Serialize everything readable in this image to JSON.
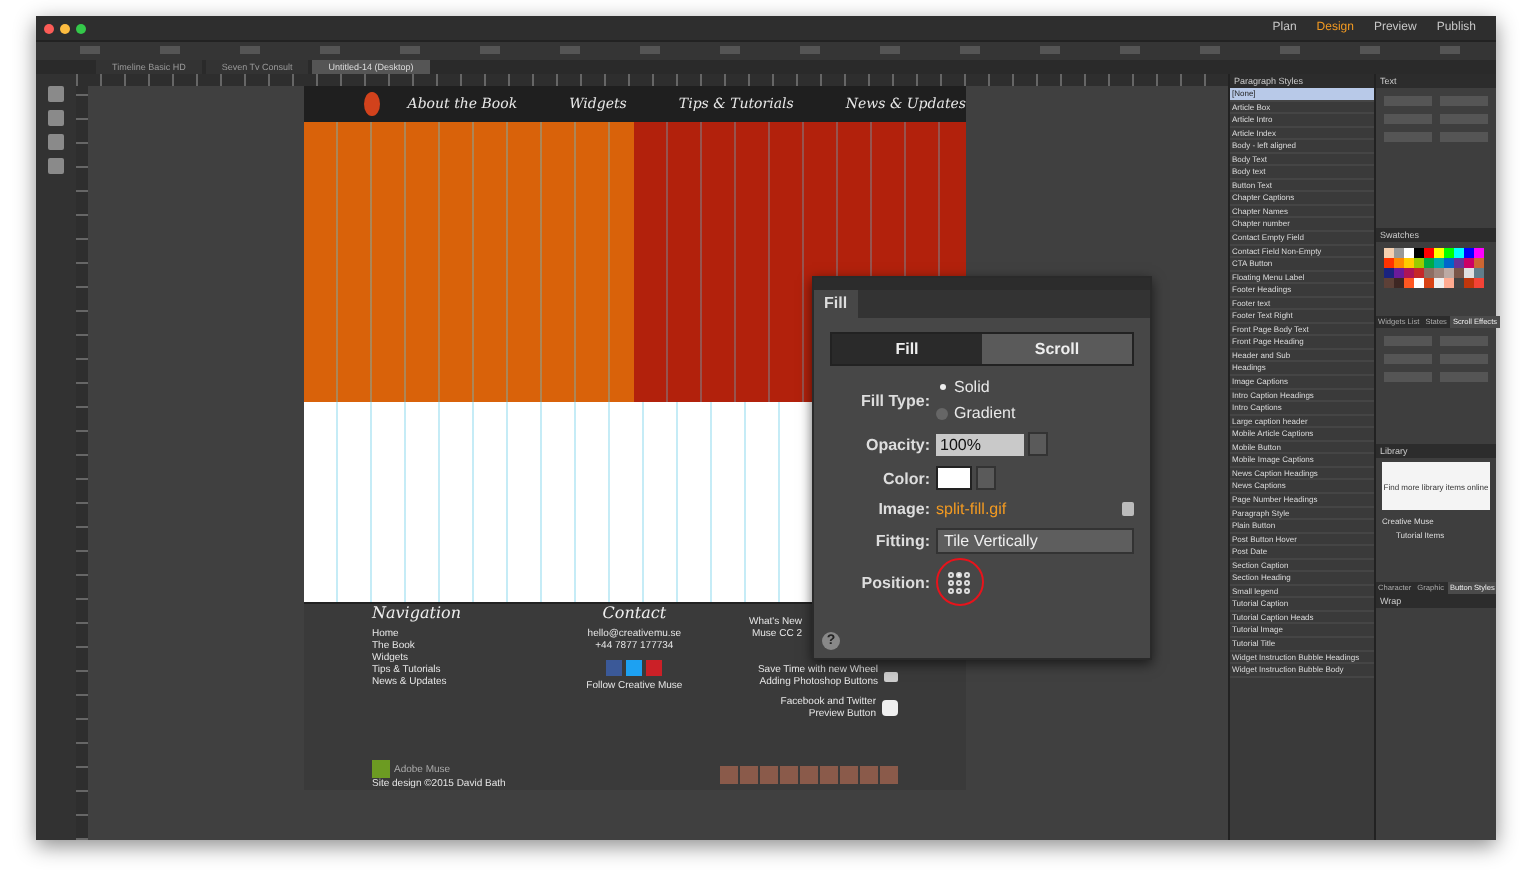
{
  "window": {
    "modes": [
      {
        "label": "Plan",
        "selected": false
      },
      {
        "label": "Design",
        "selected": true
      },
      {
        "label": "Preview",
        "selected": false
      },
      {
        "label": "Publish",
        "selected": false
      }
    ]
  },
  "document_tabs": [
    {
      "label": "Timeline Basic HD",
      "selected": false
    },
    {
      "label": "Seven Tv Consult",
      "selected": false
    },
    {
      "label": "Untitled-14 (Desktop)",
      "selected": true
    }
  ],
  "page": {
    "nav": [
      "About the Book",
      "Widgets",
      "Tips & Tutorials",
      "News & Updates"
    ],
    "footer": {
      "navigation_title": "Navigation",
      "navigation_links": [
        "Home",
        "The Book",
        "Widgets",
        "Tips & Tutorials",
        "News & Updates"
      ],
      "contact_title": "Contact",
      "contact_lines": [
        "hello@creativemu.se",
        "+44 7877 177734"
      ],
      "follow": "Follow Creative Muse",
      "news": [
        "What's New",
        "Muse CC 2"
      ],
      "tips": [
        "Save Time with new Wheel",
        "Adding Photoshop Buttons"
      ],
      "preview": [
        "Facebook and Twitter",
        "Preview Button"
      ],
      "brand": "Adobe Muse",
      "credit": "Site design ©2015 David Bath"
    }
  },
  "fill_panel": {
    "tab": "Fill",
    "toggle": [
      {
        "label": "Fill",
        "selected": true
      },
      {
        "label": "Scroll",
        "selected": false
      }
    ],
    "fill_type_label": "Fill Type:",
    "fill_types": [
      {
        "label": "Solid",
        "selected": true
      },
      {
        "label": "Gradient",
        "selected": false
      }
    ],
    "opacity_label": "Opacity:",
    "opacity": "100%",
    "color_label": "Color:",
    "image_label": "Image:",
    "image": "split-fill.gif",
    "fitting_label": "Fitting:",
    "fitting": "Tile Vertically",
    "position_label": "Position:",
    "help": "?"
  },
  "paragraph_styles": {
    "title": "Paragraph Styles",
    "items": [
      {
        "label": "[None]",
        "selected": true
      },
      {
        "label": "Article Box",
        "selected": false
      },
      {
        "label": "Article Intro",
        "selected": false
      },
      {
        "label": "Article Index",
        "selected": false
      },
      {
        "label": "Body - left aligned",
        "selected": false
      },
      {
        "label": "Body Text",
        "selected": false
      },
      {
        "label": "Body text",
        "selected": false
      },
      {
        "label": "Button Text",
        "selected": false
      },
      {
        "label": "Chapter Captions",
        "selected": false
      },
      {
        "label": "Chapter Names",
        "selected": false
      },
      {
        "label": "Chapter number",
        "selected": false
      },
      {
        "label": "Contact Empty Field",
        "selected": false
      },
      {
        "label": "Contact Field Non-Empty",
        "selected": false
      },
      {
        "label": "CTA Button",
        "selected": false
      },
      {
        "label": "Floating Menu Label",
        "selected": false
      },
      {
        "label": "Footer Headings",
        "selected": false
      },
      {
        "label": "Footer text",
        "selected": false
      },
      {
        "label": "Footer Text Right",
        "selected": false
      },
      {
        "label": "Front Page Body Text",
        "selected": false
      },
      {
        "label": "Front Page Heading",
        "selected": false
      },
      {
        "label": "Header and Sub",
        "selected": false
      },
      {
        "label": "Headings",
        "selected": false
      },
      {
        "label": "Image Captions",
        "selected": false
      },
      {
        "label": "Intro Caption Headings",
        "selected": false
      },
      {
        "label": "Intro Captions",
        "selected": false
      },
      {
        "label": "Large caption header",
        "selected": false
      },
      {
        "label": "Mobile Article Captions",
        "selected": false
      },
      {
        "label": "Mobile Button",
        "selected": false
      },
      {
        "label": "Mobile Image Captions",
        "selected": false
      },
      {
        "label": "News Caption Headings",
        "selected": false
      },
      {
        "label": "News Captions",
        "selected": false
      },
      {
        "label": "Page Number Headings",
        "selected": false
      },
      {
        "label": "Paragraph Style",
        "selected": false
      },
      {
        "label": "Plain Button",
        "selected": false
      },
      {
        "label": "Post Button Hover",
        "selected": false
      },
      {
        "label": "Post Date",
        "selected": false
      },
      {
        "label": "Section Caption",
        "selected": false
      },
      {
        "label": "Section Heading",
        "selected": false
      },
      {
        "label": "Small legend",
        "selected": false
      },
      {
        "label": "Tutorial Caption",
        "selected": false
      },
      {
        "label": "Tutorial Caption Heads",
        "selected": false
      },
      {
        "label": "Tutorial Image",
        "selected": false
      },
      {
        "label": "Tutorial Title",
        "selected": false
      },
      {
        "label": "Widget Instruction Bubble Headings",
        "selected": false
      },
      {
        "label": "Widget Instruction Bubble Body",
        "selected": false
      }
    ]
  },
  "side_panels": {
    "text_title": "Text",
    "swatches_title": "Swatches",
    "panel_tabs": [
      {
        "label": "Widgets List",
        "selected": false
      },
      {
        "label": "States",
        "selected": false
      },
      {
        "label": "Scroll Effects",
        "selected": true
      }
    ],
    "library_title": "Library",
    "library_note": "Find more library items online",
    "library_group": "Creative Muse",
    "library_item": "Tutorial Items",
    "bottom_tabs": [
      {
        "label": "Character",
        "selected": false
      },
      {
        "label": "Graphic",
        "selected": false
      },
      {
        "label": "Button Styles",
        "selected": true
      }
    ],
    "wrap_title": "Wrap"
  }
}
